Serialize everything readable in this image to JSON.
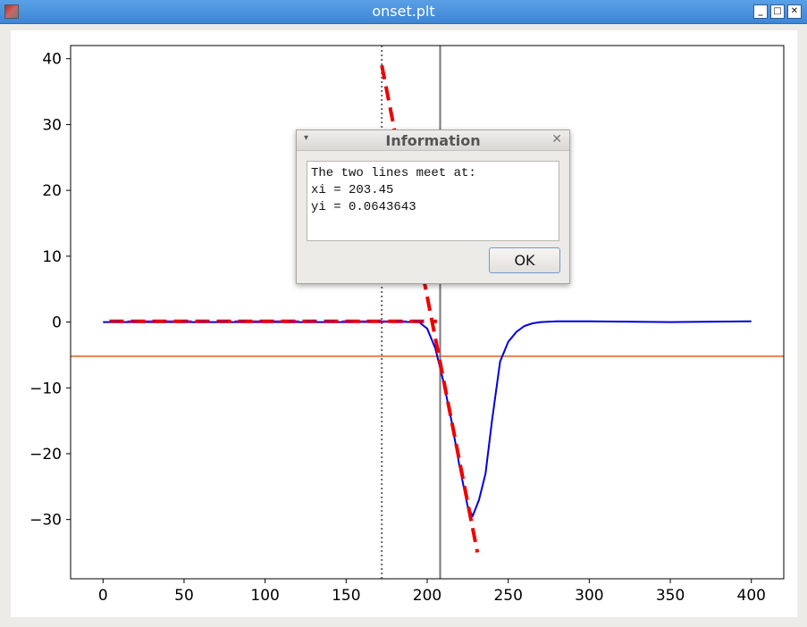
{
  "window": {
    "title": "onset.plt",
    "minimize_glyph": "_",
    "maximize_glyph": "□",
    "close_glyph": "✕"
  },
  "chart_data": {
    "type": "line",
    "xlim": [
      -20,
      420
    ],
    "ylim": [
      -39,
      42
    ],
    "xticks": [
      0,
      50,
      100,
      150,
      200,
      250,
      300,
      350,
      400
    ],
    "xtick_labels": [
      "0",
      "50",
      "100",
      "150",
      "200",
      "250",
      "300",
      "350",
      "400"
    ],
    "yticks": [
      40,
      30,
      20,
      10,
      0,
      -10,
      -20,
      -30
    ],
    "ytick_labels": [
      "40",
      "30",
      "20",
      "10",
      "0",
      "−10",
      "−20",
      "−30"
    ],
    "series": [
      {
        "style": "solid",
        "color": "#0000dd",
        "x": [
          0,
          50,
          100,
          150,
          180,
          195,
          200,
          205,
          210,
          215,
          220,
          225,
          228,
          232,
          236,
          240,
          245,
          250,
          255,
          260,
          265,
          270,
          280,
          300,
          350,
          400
        ],
        "y": [
          0,
          0,
          0,
          0,
          0.05,
          0,
          -1,
          -4,
          -9,
          -15,
          -22,
          -28,
          -29.5,
          -27,
          -23,
          -15,
          -6,
          -3,
          -1.5,
          -0.6,
          -0.2,
          0,
          0.1,
          0.1,
          0,
          0.1
        ]
      },
      {
        "style": "dashed",
        "color": "#ee0000",
        "x": [
          4,
          206
        ],
        "y": [
          0.1,
          0.1
        ]
      },
      {
        "style": "dashed",
        "color": "#ee0000",
        "x": [
          172,
          231
        ],
        "y": [
          39,
          -35
        ]
      },
      {
        "style": "dashed",
        "color": "#880088",
        "x": [
          4,
          200
        ],
        "y": [
          0.1,
          0.1
        ]
      }
    ],
    "vlines": [
      {
        "x": 172,
        "style": "dotted",
        "color": "#666666"
      },
      {
        "x": 208,
        "style": "solid",
        "color": "#777777"
      }
    ],
    "hlines": [
      {
        "y": -5.2,
        "style": "solid",
        "color": "#e0601a"
      }
    ]
  },
  "dialog": {
    "title": "Information",
    "menu_glyph": "▾",
    "close_glyph": "✕",
    "message_lines": [
      "The two lines meet at:",
      "xi = 203.45",
      "yi = 0.0643643"
    ],
    "ok_label": "OK"
  }
}
